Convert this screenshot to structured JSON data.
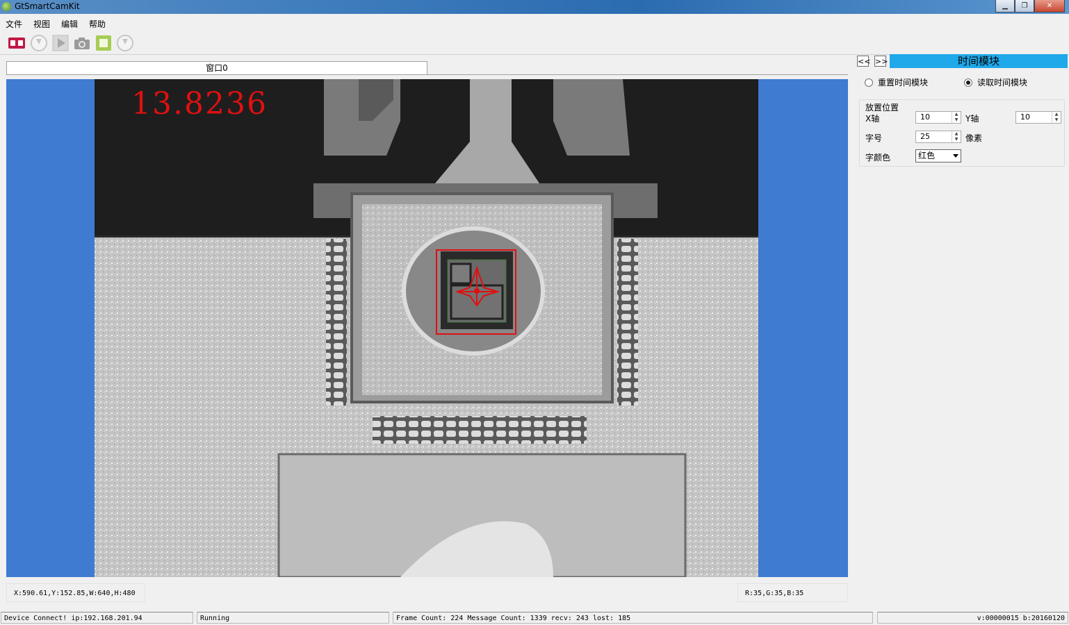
{
  "window": {
    "title": "GtSmartCamKit",
    "min_label": "▁",
    "max_label": "❐",
    "close_label": "✕"
  },
  "menu": [
    "文件",
    "视图",
    "编辑",
    "帮助"
  ],
  "toolbar": {
    "items": [
      "connect-icon",
      "download-icon",
      "play-icon",
      "camera-icon",
      "stop-icon",
      "download-icon"
    ],
    "accent": "#c21845"
  },
  "tab": {
    "label": "窗口0"
  },
  "image": {
    "overlay_value": "13.8236",
    "overlay_color": "#e01010",
    "background_color": "#3f7bd0"
  },
  "readouts": {
    "coords": "X:590.61,Y:152.85,W:640,H:480",
    "rgb": "R:35,G:35,B:35"
  },
  "statusbar": {
    "device": "Device Connect! ip:192.168.201.94",
    "state": "Running",
    "counts": "Frame Count: 224 Message Count: 1339  recv: 243  lost: 185",
    "version": "v:00000015 b:20160120"
  },
  "panel": {
    "prev_label": "<<",
    "next_label": ">>",
    "title": "时间模块",
    "radio_reset": "重置时间模块",
    "radio_read": "读取时间模块",
    "radio_selected": "read",
    "group_title": "放置位置",
    "x_label": "X轴",
    "x_value": "10",
    "y_label": "Y轴",
    "y_value": "10",
    "size_label": "字号",
    "size_value": "25",
    "size_unit": "像素",
    "color_label": "字颜色",
    "color_value": "红色"
  }
}
